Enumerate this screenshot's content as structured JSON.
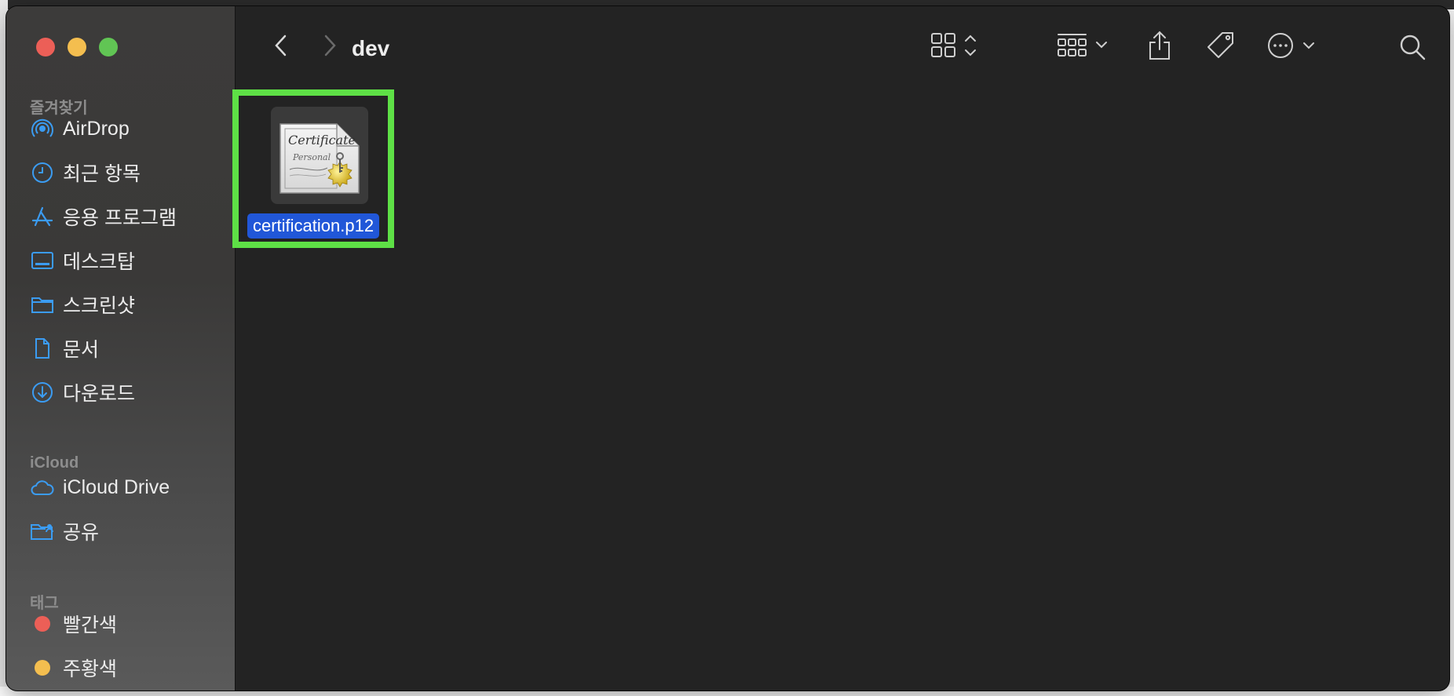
{
  "window": {
    "title": "dev"
  },
  "sidebar": {
    "favorites_title": "즐겨찾기",
    "favorites": [
      {
        "label": "AirDrop",
        "icon": "airdrop-icon"
      },
      {
        "label": "최근 항목",
        "icon": "clock-icon"
      },
      {
        "label": "응용 프로그램",
        "icon": "applications-icon"
      },
      {
        "label": "데스크탑",
        "icon": "desktop-icon"
      },
      {
        "label": "스크린샷",
        "icon": "folder-icon"
      },
      {
        "label": "문서",
        "icon": "document-icon"
      },
      {
        "label": "다운로드",
        "icon": "download-icon"
      }
    ],
    "icloud_title": "iCloud",
    "icloud": [
      {
        "label": "iCloud Drive",
        "icon": "cloud-icon"
      },
      {
        "label": "공유",
        "icon": "shared-folder-icon"
      }
    ],
    "tags_title": "태그",
    "tags": [
      {
        "label": "빨간색",
        "color": "#ec5f57"
      },
      {
        "label": "주황색",
        "color": "#f4be4f"
      }
    ]
  },
  "files": [
    {
      "name": "certification.p12",
      "selected": true,
      "icon_text_1": "Certificate",
      "icon_text_2": "Personal"
    }
  ],
  "colors": {
    "accent": "#2157d8",
    "highlight": "#5ee046"
  }
}
